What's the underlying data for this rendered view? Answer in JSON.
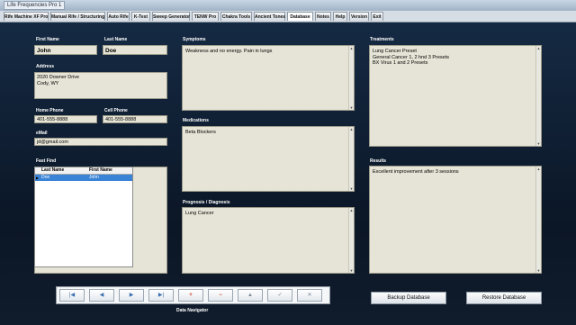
{
  "window": {
    "title": "Life Frequencies Pro 1"
  },
  "tabs": [
    {
      "label": "Rife Machine XF Pro",
      "active": false
    },
    {
      "label": "Manual Rife / Structuring",
      "active": false
    },
    {
      "label": "Auto Rife",
      "active": false
    },
    {
      "label": "K-Test",
      "active": false
    },
    {
      "label": "Sweep Generator",
      "active": false
    },
    {
      "label": "TENW Pro",
      "active": false
    },
    {
      "label": "Chakra Tools",
      "active": false
    },
    {
      "label": "Ancient Tones",
      "active": false
    },
    {
      "label": "Database",
      "active": true
    },
    {
      "label": "Notes",
      "active": false
    },
    {
      "label": "Help",
      "active": false
    },
    {
      "label": "Version",
      "active": false
    },
    {
      "label": "Exit",
      "active": false
    }
  ],
  "form": {
    "first_name": {
      "label": "First Name",
      "value": "John"
    },
    "last_name": {
      "label": "Last Name",
      "value": "Doe"
    },
    "address": {
      "label": "Address",
      "value": "2020 Downer Drive\nCody, WY"
    },
    "home_phone": {
      "label": "Home Phone",
      "value": "401-555-8888"
    },
    "cell_phone": {
      "label": "Cell Phone",
      "value": "401-555-8888"
    },
    "email": {
      "label": "eMail",
      "value": "jd@gmail.com"
    },
    "symptoms": {
      "label": "Symptoms",
      "value": "Weakness and no energy. Pain in lungs"
    },
    "medications": {
      "label": "Medications",
      "value": "Beta Blockers"
    },
    "prognosis": {
      "label": "Prognosis / Diagnosis",
      "value": "Lung Cancer"
    },
    "treatments": {
      "label": "Treatments",
      "value": "Lung Cancer Preset\nGeneral Cancer 1, 2 hnd 3 Presets\nBX Virus 1 and 2 Presets"
    },
    "results": {
      "label": "Results",
      "value": "Excellent improvement after 3 sessions"
    }
  },
  "fast_find": {
    "label": "Fast Find",
    "columns": [
      "Last Name",
      "First Name"
    ],
    "rows": [
      {
        "last": "Doe",
        "first": "John",
        "selected": true
      }
    ]
  },
  "navigator": {
    "label": "Data Navigator",
    "buttons": [
      {
        "name": "first-record-button",
        "glyph": "|◀",
        "style": "blue"
      },
      {
        "name": "prior-record-button",
        "glyph": "◀",
        "style": "blue"
      },
      {
        "name": "next-record-button",
        "glyph": "▶",
        "style": "blue"
      },
      {
        "name": "last-record-button",
        "glyph": "▶|",
        "style": "blue"
      },
      {
        "name": "insert-record-button",
        "glyph": "+",
        "style": "red"
      },
      {
        "name": "delete-record-button",
        "glyph": "−",
        "style": "red"
      },
      {
        "name": "edit-record-button",
        "glyph": "▲",
        "style": "grey"
      },
      {
        "name": "post-edit-button",
        "glyph": "✓",
        "style": "grey"
      },
      {
        "name": "cancel-edit-button",
        "glyph": "✕",
        "style": "grey"
      }
    ]
  },
  "actions": {
    "backup": "Backup Database",
    "restore": "Restore Database"
  }
}
